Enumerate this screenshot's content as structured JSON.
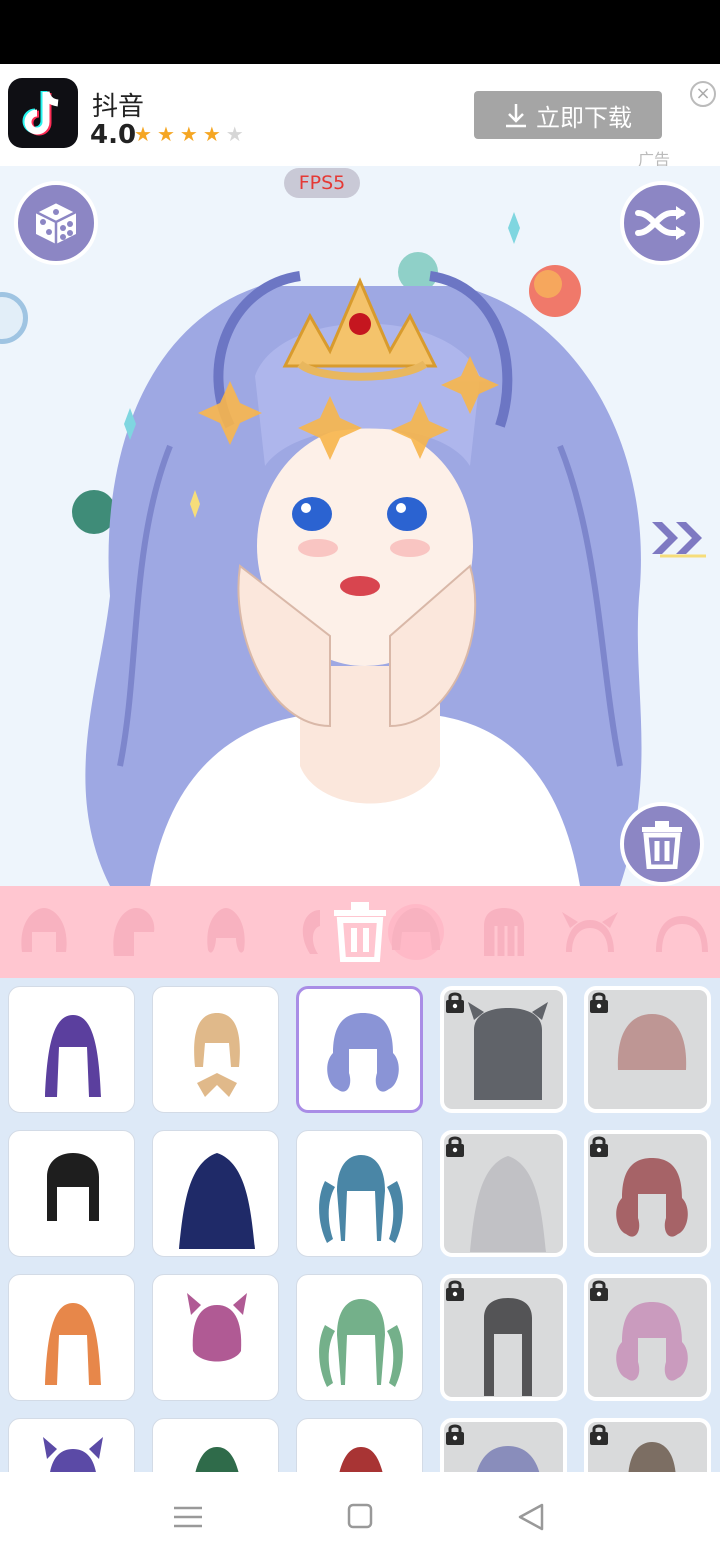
{
  "ad": {
    "app_name": "抖音",
    "rating": "4.0",
    "stars": [
      "★",
      "★",
      "★",
      "★",
      "★"
    ],
    "download_label": "立即下载",
    "ad_tag": "广告",
    "close_glyph": "×"
  },
  "stage": {
    "fps_label": "FPS5",
    "icons": [
      "dice-icon",
      "shuffle-icon",
      "trash-icon",
      "next-arrow-icon"
    ]
  },
  "category_bar": {
    "icons": [
      "hair-front-icon",
      "hair-side-icon",
      "hair-bun-icon",
      "hair-partial-icon",
      "hair-bangs-icon",
      "hair-striped-icon",
      "horns-icon",
      "headband-icon"
    ],
    "delete_icon": "trash-icon",
    "color": "#ffc6d0"
  },
  "hair_tiles": [
    {
      "color": "#5b3f9e",
      "style": "long",
      "locked": false,
      "selected": false
    },
    {
      "color": "#e0b98a",
      "style": "bow",
      "locked": false,
      "selected": false
    },
    {
      "color": "#8a94d6",
      "style": "curls",
      "locked": false,
      "selected": true
    },
    {
      "color": "#4a4e55",
      "style": "horns",
      "locked": true,
      "selected": false
    },
    {
      "color": "#b98a87",
      "style": "bob",
      "locked": true,
      "selected": false
    },
    {
      "color": "#1e1e1e",
      "style": "blunt",
      "locked": false,
      "selected": false
    },
    {
      "color": "#1f2a68",
      "style": "wavy",
      "locked": false,
      "selected": false
    },
    {
      "color": "#4a86a6",
      "style": "twintails",
      "locked": false,
      "selected": false
    },
    {
      "color": "#bcbcc1",
      "style": "wavy",
      "locked": true,
      "selected": false
    },
    {
      "color": "#9c4d52",
      "style": "curls",
      "locked": true,
      "selected": false
    },
    {
      "color": "#e7874a",
      "style": "long",
      "locked": false,
      "selected": false
    },
    {
      "color": "#b05a94",
      "style": "buns",
      "locked": false,
      "selected": false
    },
    {
      "color": "#74b08a",
      "style": "twintails",
      "locked": false,
      "selected": false
    },
    {
      "color": "#3c3c3e",
      "style": "straight",
      "locked": true,
      "selected": false
    },
    {
      "color": "#c78fb8",
      "style": "curls",
      "locked": true,
      "selected": false
    },
    {
      "color": "#5b4aa6",
      "style": "buns",
      "locked": false,
      "selected": false
    },
    {
      "color": "#2f6b4a",
      "style": "long",
      "locked": false,
      "selected": false
    },
    {
      "color": "#a83434",
      "style": "long",
      "locked": false,
      "selected": false
    },
    {
      "color": "#7a7fb5",
      "style": "bob",
      "locked": true,
      "selected": false
    },
    {
      "color": "#6b5a4e",
      "style": "braid",
      "locked": true,
      "selected": false
    }
  ],
  "nav": {
    "icons": [
      "menu-icon",
      "home-icon",
      "back-icon"
    ]
  },
  "colors": {
    "accent": "#8c86c4",
    "selected_border": "#a98de6",
    "grid_bg": "#dde9f7"
  }
}
